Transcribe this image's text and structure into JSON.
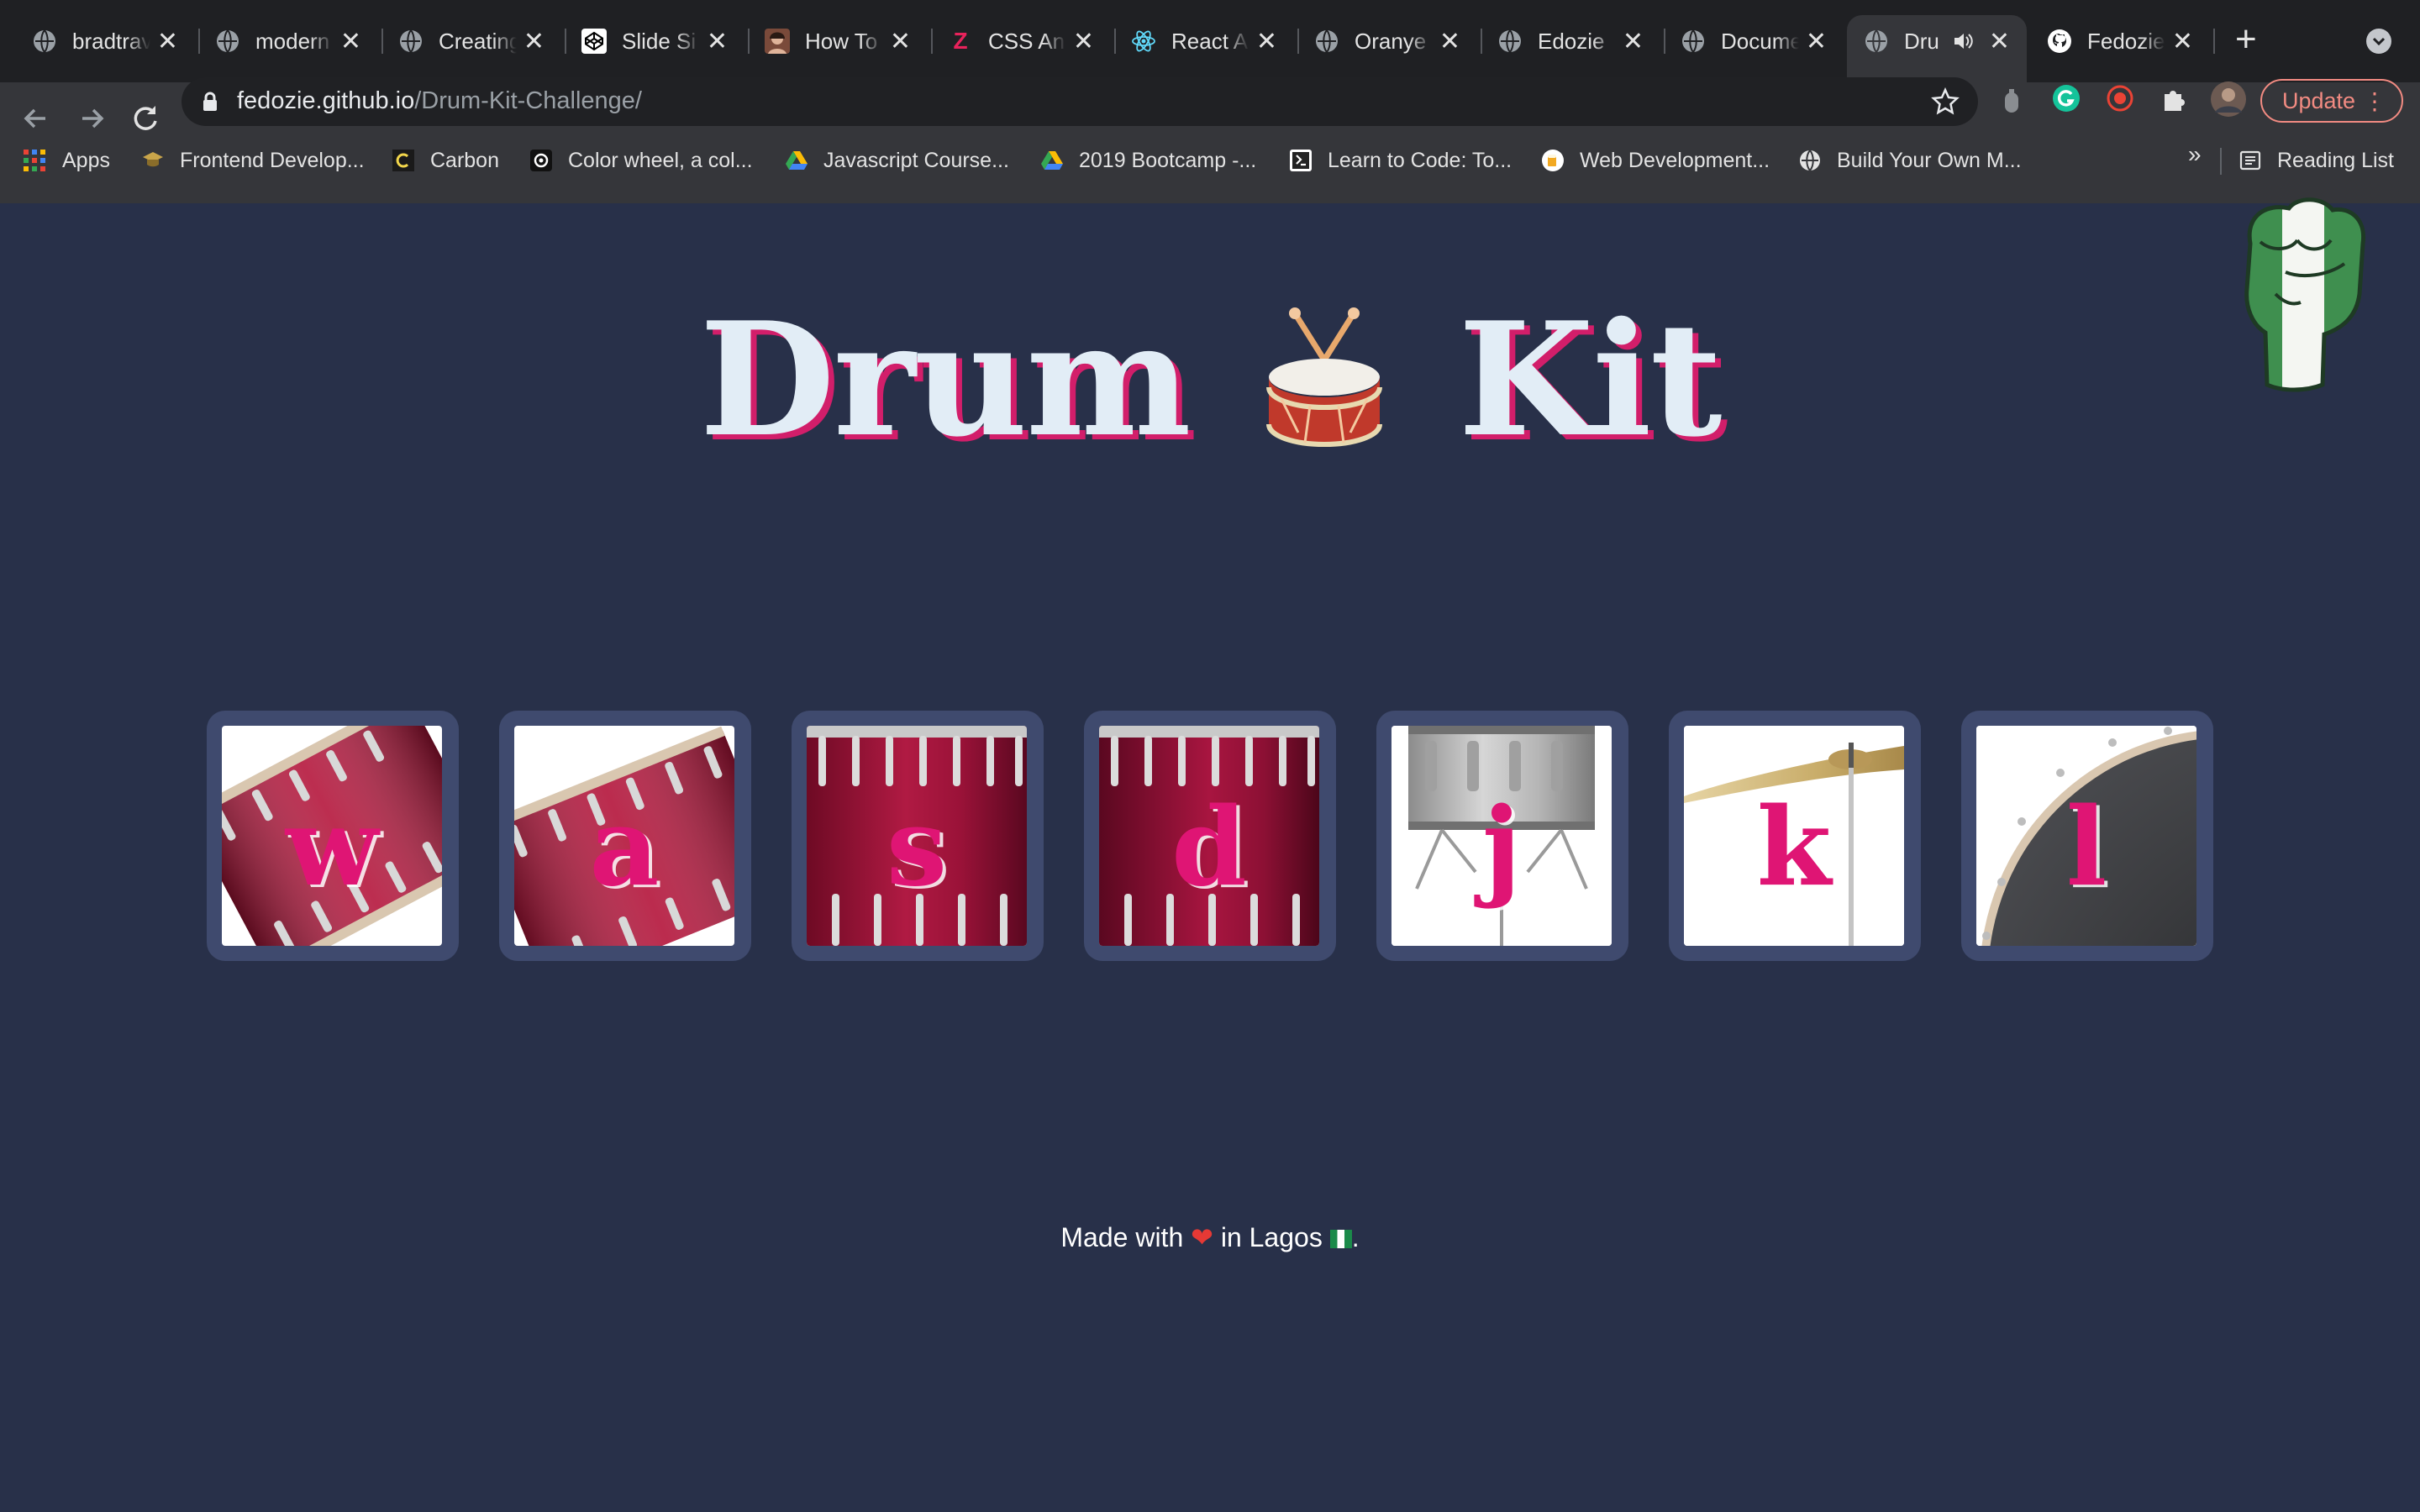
{
  "browser": {
    "tabs": [
      {
        "title": "bradtrav",
        "icon": "globe-icon"
      },
      {
        "title": "modern",
        "icon": "globe-icon"
      },
      {
        "title": "Creating",
        "icon": "globe-icon"
      },
      {
        "title": "Slide Si",
        "icon": "codepen-icon"
      },
      {
        "title": "How To",
        "icon": "avatar-icon"
      },
      {
        "title": "CSS Ani",
        "icon": "z-logo-icon"
      },
      {
        "title": "React A",
        "icon": "react-icon"
      },
      {
        "title": "Oranye",
        "icon": "globe-icon"
      },
      {
        "title": "Edozie",
        "icon": "globe-icon"
      },
      {
        "title": "Docume",
        "icon": "globe-icon"
      },
      {
        "title": "Dru",
        "icon": "globe-icon",
        "active": true,
        "audio": true
      },
      {
        "title": "Fedozie",
        "icon": "github-icon"
      }
    ],
    "url_host": "fedozie.github.io",
    "url_path": "/Drum-Kit-Challenge/",
    "update_label": "Update",
    "bookmarks": [
      {
        "label": "Apps",
        "icon": "apps-grid-icon"
      },
      {
        "label": "Frontend Develop...",
        "icon": "graduation-cap-icon"
      },
      {
        "label": "Carbon",
        "icon": "carbon-icon"
      },
      {
        "label": "Color wheel, a col...",
        "icon": "adobe-color-icon"
      },
      {
        "label": "Javascript Course...",
        "icon": "google-drive-icon"
      },
      {
        "label": "2019 Bootcamp -...",
        "icon": "google-drive-icon"
      },
      {
        "label": "Learn to Code: To...",
        "icon": "freecodecamp-icon"
      },
      {
        "label": "Web Development...",
        "icon": "beer-icon"
      },
      {
        "label": "Build Your Own M...",
        "icon": "globe-icon"
      }
    ],
    "overflow_label": "»",
    "reading_list_label": "Reading List"
  },
  "page": {
    "title_left": "Drum",
    "title_right": "Kit",
    "title_emoji": "drum-emoji",
    "keys": [
      {
        "letter": "w",
        "image": "tom-drum-tilted"
      },
      {
        "letter": "a",
        "image": "tom-drum-tilted"
      },
      {
        "letter": "s",
        "image": "bass-drum-side"
      },
      {
        "letter": "d",
        "image": "bass-drum-side"
      },
      {
        "letter": "j",
        "image": "snare-drum"
      },
      {
        "letter": "k",
        "image": "cymbal"
      },
      {
        "letter": "l",
        "image": "drum-head"
      }
    ],
    "footer_prefix": "Made with",
    "footer_mid": "in Lagos",
    "footer_suffix": ".",
    "accent_color": "#df1574",
    "background_color": "#283049"
  }
}
